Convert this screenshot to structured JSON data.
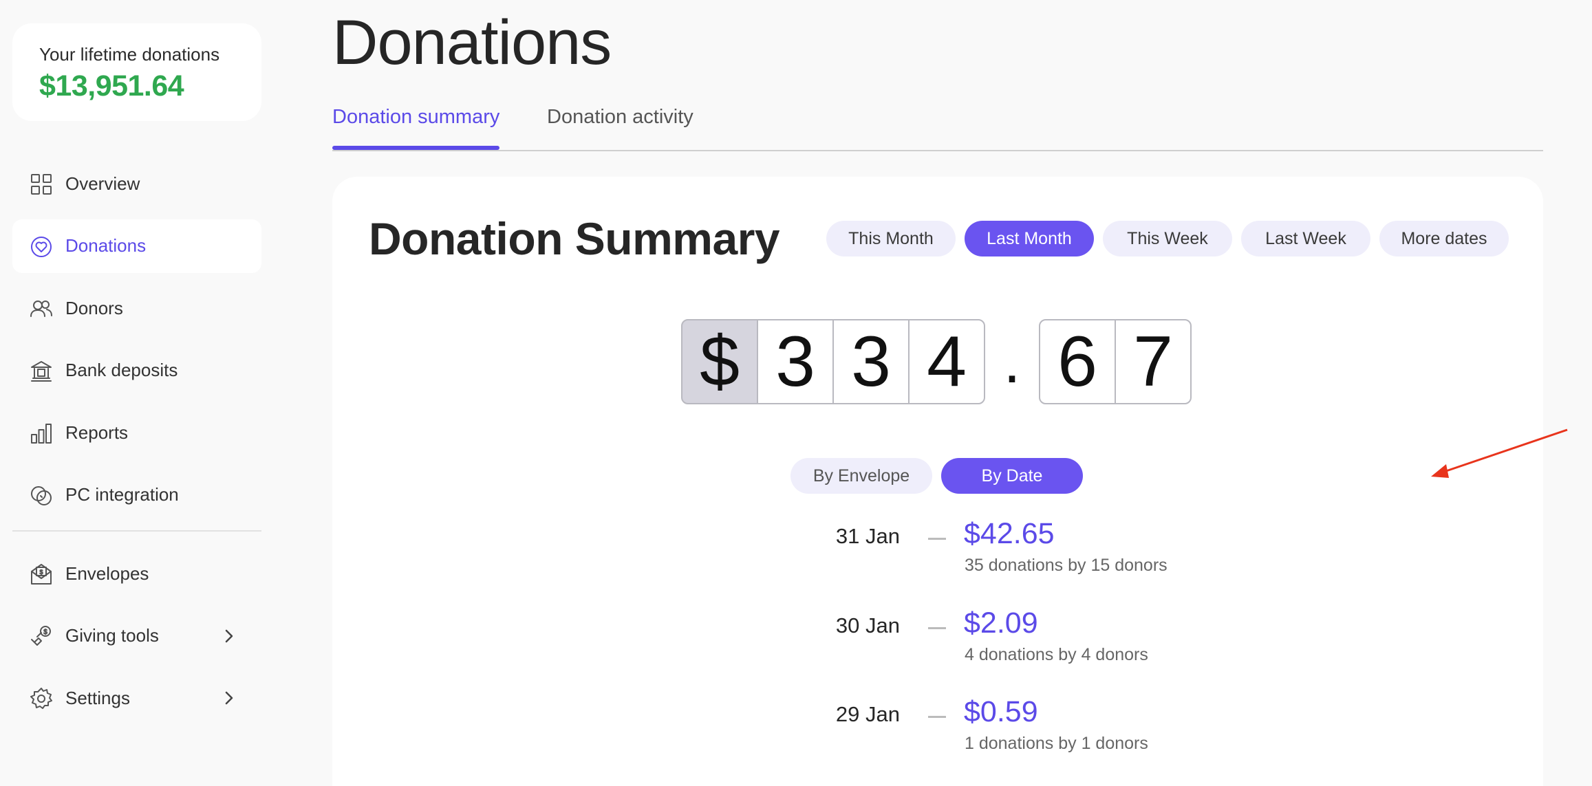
{
  "sidebar": {
    "lifetime_label": "Your lifetime donations",
    "lifetime_value": "$13,951.64",
    "items": [
      {
        "label": "Overview",
        "icon": "grid-icon"
      },
      {
        "label": "Donations",
        "icon": "heart-circle-icon",
        "active": true
      },
      {
        "label": "Donors",
        "icon": "people-icon"
      },
      {
        "label": "Bank deposits",
        "icon": "bank-icon"
      },
      {
        "label": "Reports",
        "icon": "bar-chart-icon"
      },
      {
        "label": "PC integration",
        "icon": "link-icon"
      },
      {
        "label": "Envelopes",
        "icon": "envelope-dollar-icon"
      },
      {
        "label": "Giving tools",
        "icon": "giving-hand-icon"
      },
      {
        "label": "Settings",
        "icon": "gear-icon"
      }
    ]
  },
  "header": {
    "title": "Donations",
    "tabs": [
      {
        "label": "Donation summary",
        "active": true
      },
      {
        "label": "Donation activity",
        "active": false
      }
    ]
  },
  "summary": {
    "title": "Donation Summary",
    "date_filters": [
      {
        "label": "This Month"
      },
      {
        "label": "Last Month",
        "active": true
      },
      {
        "label": "This Week"
      },
      {
        "label": "Last Week"
      },
      {
        "label": "More dates"
      }
    ],
    "total_digits": {
      "currency": "$",
      "d1": "3",
      "d2": "3",
      "d3": "4",
      "decimal": ".",
      "c1": "6",
      "c2": "7"
    },
    "view_toggle": [
      {
        "label": "By Envelope"
      },
      {
        "label": "By Date",
        "active": true
      }
    ],
    "entries": [
      {
        "date": "31 Jan",
        "amount": "$42.65",
        "detail": "35 donations by 15 donors"
      },
      {
        "date": "30 Jan",
        "amount": "$2.09",
        "detail": "4 donations by 4 donors"
      },
      {
        "date": "29 Jan",
        "amount": "$0.59",
        "detail": "1 donations by 1 donors"
      }
    ]
  },
  "colors": {
    "accent": "#5b4ae8",
    "accent_chip": "#6a54f0",
    "lifetime_green": "#2fa84f",
    "annotation_arrow": "#e8341c"
  }
}
